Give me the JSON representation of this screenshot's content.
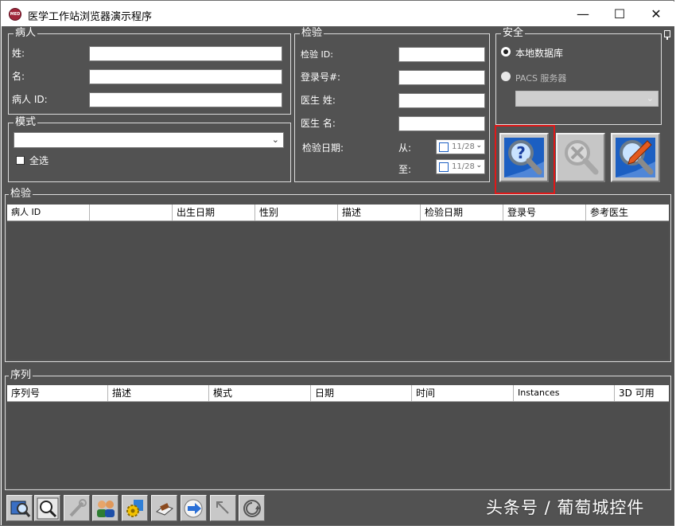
{
  "window": {
    "icon_text": "MED",
    "title": "医学工作站浏览器演示程序",
    "minimize": "—",
    "maximize": "☐",
    "close": "✕"
  },
  "patient": {
    "title": "病人",
    "last_name_label": "姓:",
    "first_name_label": "名:",
    "id_label": "病人 ID:",
    "last_name_value": "",
    "first_name_value": "",
    "id_value": ""
  },
  "modality": {
    "title": "模式",
    "selected": "",
    "select_all_label": "全选",
    "select_all_checked": false
  },
  "exam": {
    "title": "检验",
    "exam_id_label": "检验 ID:",
    "accession_label": "登录号#:",
    "doctor_last_label": "医生 姓:",
    "doctor_first_label": "医生 名:",
    "exam_date_label": "检验日期:",
    "from_label": "从:",
    "to_label": "至:",
    "from_date": "11/28",
    "to_date": "11/28"
  },
  "security": {
    "title": "安全",
    "local_db_label": "本地数据库",
    "pacs_label": "PACS 服务器",
    "selected": "local",
    "pacs_server_value": ""
  },
  "actions": {
    "search_icon": "search-query-icon",
    "clear_icon": "clear-search-icon",
    "edit_icon": "edit-query-icon"
  },
  "exam_list": {
    "title": "检验",
    "columns": [
      "病人 ID",
      "",
      "出生日期",
      "性别",
      "描述",
      "检验日期",
      "登录号",
      "参考医生"
    ],
    "rows": []
  },
  "series_list": {
    "title": "序列",
    "columns": [
      "序列号",
      "描述",
      "模式",
      "日期",
      "时间",
      "Instances",
      "3D 可用"
    ],
    "rows": []
  },
  "toolbar": {
    "items": [
      "patient-browser-icon",
      "search-icon",
      "tools-icon",
      "users-icon",
      "settings-gear-icon",
      "storage-icon",
      "eraser-icon",
      "send-disc-icon",
      "cursor-icon",
      "refresh-icon"
    ]
  },
  "watermark": "头条号 / 葡萄城控件",
  "colors": {
    "client_bg": "#525252",
    "grid_bg": "#4d4d4d",
    "highlight": "#e01818",
    "accent_blue": "#1c5fc2"
  }
}
